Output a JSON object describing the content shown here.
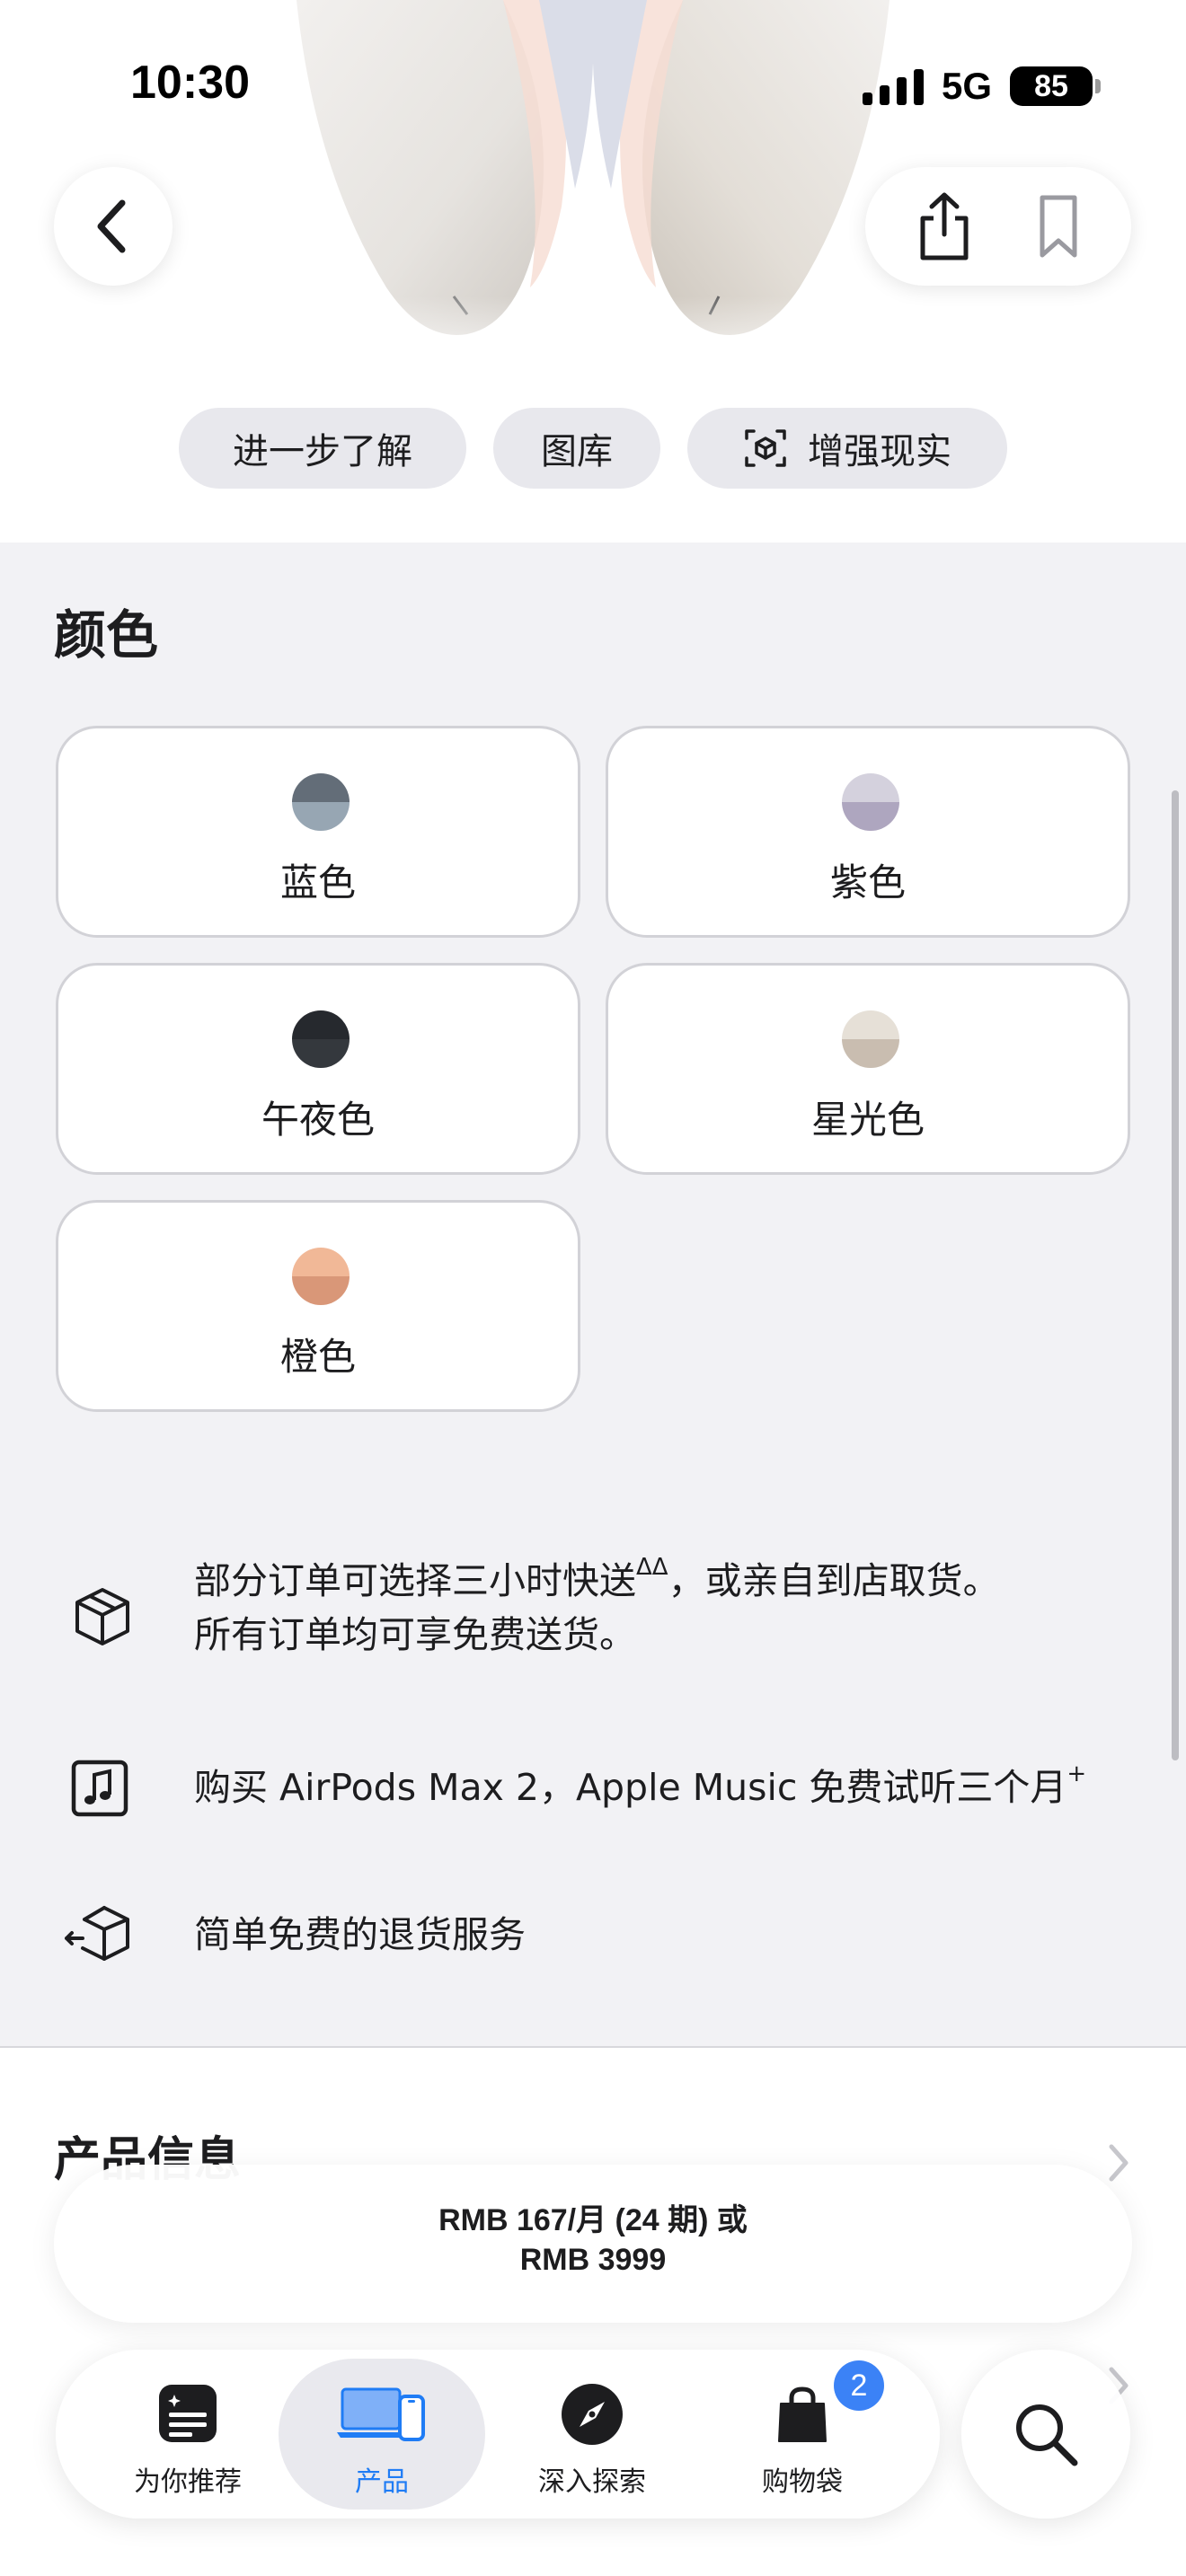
{
  "status_bar": {
    "time": "10:30",
    "network": "5G",
    "battery": "85"
  },
  "hero_actions": {
    "chips": [
      {
        "label": "进一步了解"
      },
      {
        "label": "图库"
      },
      {
        "label": "增强现实",
        "icon": "ar-icon"
      }
    ]
  },
  "color_section": {
    "title": "颜色",
    "options": [
      {
        "label": "蓝色",
        "swatch_top": "#636d78",
        "swatch_bottom": "#97a6b3"
      },
      {
        "label": "紫色",
        "swatch_top": "#d4d1dd",
        "swatch_bottom": "#aea6bf"
      },
      {
        "label": "午夜色",
        "swatch_top": "#26292e",
        "swatch_bottom": "#34383d"
      },
      {
        "label": "星光色",
        "swatch_top": "#e6e0d7",
        "swatch_bottom": "#c9bdb0"
      },
      {
        "label": "橙色",
        "swatch_top": "#f1b897",
        "swatch_bottom": "#d99778"
      }
    ]
  },
  "info": {
    "delivery_line1": "部分订单可选择三小时快送",
    "delivery_sup": "ΔΔ",
    "delivery_line1_end": "，或亲自到店取货。",
    "delivery_line2": "所有订单均可享免费送货。",
    "music_text": "购买 AirPods Max 2，Apple Music 免费试听三个月",
    "music_sup": "+",
    "return_text": "简单免费的退货服务"
  },
  "product_info": {
    "title": "产品信息"
  },
  "price": {
    "line1": "RMB 167/月 (24 期) 或",
    "line2": "RMB 3999"
  },
  "tab_bar": {
    "tabs": [
      {
        "label": "为你推荐",
        "icon": "for-you-icon"
      },
      {
        "label": "产品",
        "icon": "products-icon",
        "active": true
      },
      {
        "label": "深入探索",
        "icon": "compass-icon"
      },
      {
        "label": "购物袋",
        "icon": "bag-icon",
        "badge": "2"
      }
    ]
  },
  "colors": {
    "accent": "#1f7cf5",
    "badge": "#3b82f6",
    "background": "#f2f2f5"
  }
}
